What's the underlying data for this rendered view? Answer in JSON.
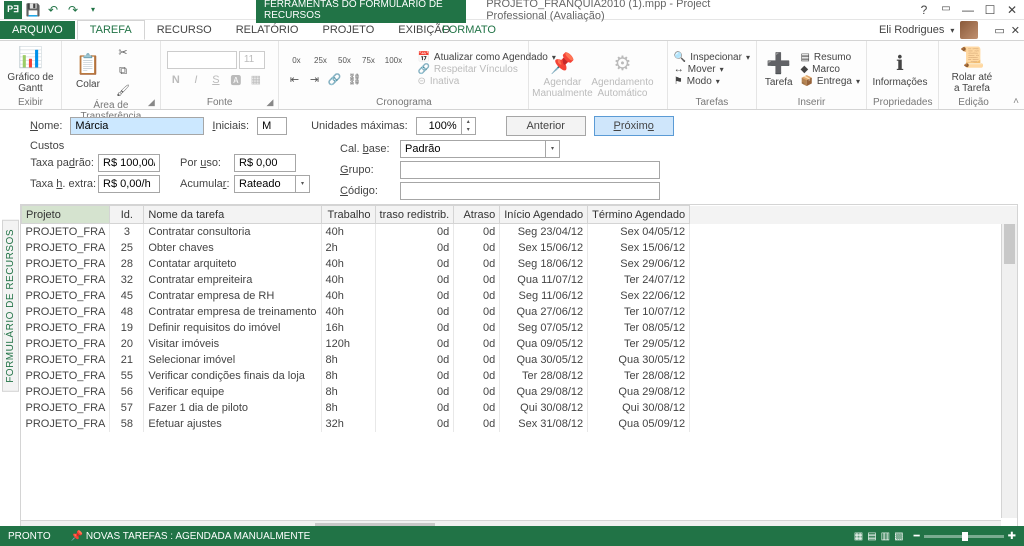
{
  "app": {
    "tool_tab": "FERRAMENTAS DO FORMULÁRIO DE RECURSOS",
    "doc_title": "PROJETO_FRANQUIA2010 (1).mpp - Project Professional (Avaliação)",
    "user": "Eli Rodrigues"
  },
  "tabs": {
    "file": "ARQUIVO",
    "items": [
      "TAREFA",
      "RECURSO",
      "RELATÓRIO",
      "PROJETO",
      "EXIBIÇÃO"
    ],
    "format": "FORMATO",
    "active": "TAREFA"
  },
  "ribbon": {
    "exibir": {
      "label": "Exibir",
      "btn": "Gráfico de\nGantt"
    },
    "area": {
      "label": "Área de Transferência",
      "btn": "Colar"
    },
    "fonte": {
      "label": "Fonte",
      "size": "11"
    },
    "cronograma": {
      "label": "Cronograma",
      "atualizar": "Atualizar como Agendado",
      "respeitar": "Respeitar Vínculos",
      "inativa": "Inativa"
    },
    "tarefas_sched": {
      "label": "",
      "manual": "Agendar\nManualmente",
      "auto": "Agendamento\nAutomático"
    },
    "tarefas": {
      "label": "Tarefas",
      "inspecionar": "Inspecionar",
      "mover": "Mover",
      "modo": "Modo"
    },
    "inserir": {
      "label": "Inserir",
      "tarefa": "Tarefa",
      "resumo": "Resumo",
      "marco": "Marco",
      "entrega": "Entrega"
    },
    "propriedades": {
      "label": "Propriedades",
      "btn": "Informações"
    },
    "edicao": {
      "label": "Edição",
      "btn": "Rolar até\na Tarefa"
    }
  },
  "form": {
    "nome_label": "Nome:",
    "nome": "Márcia",
    "iniciais_label": "Iniciais:",
    "iniciais": "M",
    "unidades_label": "Unidades máximas:",
    "unidades": "100%",
    "anterior": "Anterior",
    "proximo": "Próximo",
    "custos_header": "Custos",
    "taxa_padrao_label": "Taxa padrão:",
    "taxa_padrao": "R$ 100,00/h",
    "taxa_extra_label": "Taxa h. extra:",
    "taxa_extra": "R$ 0,00/h",
    "por_uso_label": "Por uso:",
    "por_uso": "R$ 0,00",
    "acumular_label": "Acumular:",
    "acumular": "Rateado",
    "cal_base_label": "Cal. base:",
    "cal_base": "Padrão",
    "grupo_label": "Grupo:",
    "grupo": "",
    "codigo_label": "Código:",
    "codigo": ""
  },
  "side_label": "FORMULÁRIO DE RECURSOS",
  "table": {
    "headers": [
      "Projeto",
      "Id.",
      "Nome da tarefa",
      "Trabalho",
      "traso redistrib.",
      "Atraso",
      "Início Agendado",
      "Término Agendado"
    ],
    "rows": [
      {
        "proj": "PROJETO_FRA",
        "id": "3",
        "nome": "Contratar consultoria",
        "trab": "40h",
        "red": "0d",
        "atraso": "0d",
        "ini": "Seg 23/04/12",
        "fim": "Sex 04/05/12"
      },
      {
        "proj": "PROJETO_FRA",
        "id": "25",
        "nome": "Obter chaves",
        "trab": "2h",
        "red": "0d",
        "atraso": "0d",
        "ini": "Sex 15/06/12",
        "fim": "Sex 15/06/12"
      },
      {
        "proj": "PROJETO_FRA",
        "id": "28",
        "nome": "Contatar arquiteto",
        "trab": "40h",
        "red": "0d",
        "atraso": "0d",
        "ini": "Seg 18/06/12",
        "fim": "Sex 29/06/12"
      },
      {
        "proj": "PROJETO_FRA",
        "id": "32",
        "nome": "Contratar empreiteira",
        "trab": "40h",
        "red": "0d",
        "atraso": "0d",
        "ini": "Qua 11/07/12",
        "fim": "Ter 24/07/12"
      },
      {
        "proj": "PROJETO_FRA",
        "id": "45",
        "nome": "Contratar empresa de RH",
        "trab": "40h",
        "red": "0d",
        "atraso": "0d",
        "ini": "Seg 11/06/12",
        "fim": "Sex 22/06/12"
      },
      {
        "proj": "PROJETO_FRA",
        "id": "48",
        "nome": "Contratar empresa de treinamento",
        "trab": "40h",
        "red": "0d",
        "atraso": "0d",
        "ini": "Qua 27/06/12",
        "fim": "Ter 10/07/12"
      },
      {
        "proj": "PROJETO_FRA",
        "id": "19",
        "nome": "Definir requisitos do imóvel",
        "trab": "16h",
        "red": "0d",
        "atraso": "0d",
        "ini": "Seg 07/05/12",
        "fim": "Ter 08/05/12"
      },
      {
        "proj": "PROJETO_FRA",
        "id": "20",
        "nome": "Visitar imóveis",
        "trab": "120h",
        "red": "0d",
        "atraso": "0d",
        "ini": "Qua 09/05/12",
        "fim": "Ter 29/05/12"
      },
      {
        "proj": "PROJETO_FRA",
        "id": "21",
        "nome": "Selecionar imóvel",
        "trab": "8h",
        "red": "0d",
        "atraso": "0d",
        "ini": "Qua 30/05/12",
        "fim": "Qua 30/05/12"
      },
      {
        "proj": "PROJETO_FRA",
        "id": "55",
        "nome": "Verificar condições finais da loja",
        "trab": "8h",
        "red": "0d",
        "atraso": "0d",
        "ini": "Ter 28/08/12",
        "fim": "Ter 28/08/12"
      },
      {
        "proj": "PROJETO_FRA",
        "id": "56",
        "nome": "Verificar equipe",
        "trab": "8h",
        "red": "0d",
        "atraso": "0d",
        "ini": "Qua 29/08/12",
        "fim": "Qua 29/08/12"
      },
      {
        "proj": "PROJETO_FRA",
        "id": "57",
        "nome": "Fazer 1 dia de piloto",
        "trab": "8h",
        "red": "0d",
        "atraso": "0d",
        "ini": "Qui 30/08/12",
        "fim": "Qui 30/08/12"
      },
      {
        "proj": "PROJETO_FRA",
        "id": "58",
        "nome": "Efetuar ajustes",
        "trab": "32h",
        "red": "0d",
        "atraso": "0d",
        "ini": "Sex 31/08/12",
        "fim": "Qua 05/09/12"
      }
    ]
  },
  "status": {
    "ready": "PRONTO",
    "mode": "NOVAS TAREFAS : AGENDADA MANUALMENTE"
  }
}
